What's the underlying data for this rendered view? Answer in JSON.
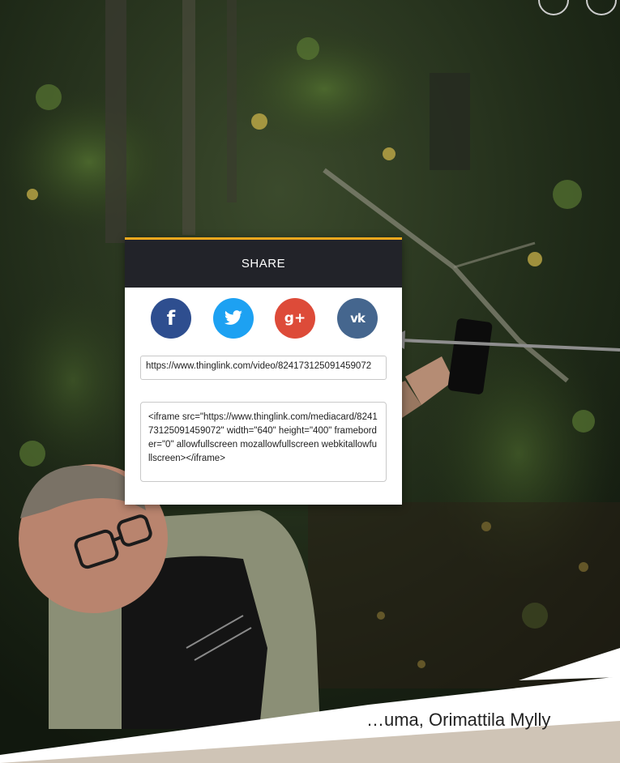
{
  "modal": {
    "title": "SHARE",
    "accent_color": "#f0a81e",
    "header_color": "#222329",
    "social": [
      {
        "name": "facebook",
        "icon": "facebook-icon",
        "glyph": "f",
        "color": "#2e4e8f"
      },
      {
        "name": "twitter",
        "icon": "twitter-icon",
        "glyph": "bird",
        "color": "#1da1f2"
      },
      {
        "name": "google-plus",
        "icon": "google-plus-icon",
        "glyph": "g+",
        "color": "#dd4b39"
      },
      {
        "name": "vk",
        "icon": "vk-icon",
        "glyph": "vk",
        "color": "#45668e"
      }
    ],
    "url_value": "https://www.thinglink.com/video/824173125091459072",
    "embed_value": "<iframe src=\"https://www.thinglink.com/mediacard/824173125091459072\" width=\"640\" height=\"400\" frameborder=\"0\" allowfullscreen mozallowfullscreen webkitallowfullscreen></iframe>"
  },
  "caption": {
    "text": "…uma, Orimattila Mylly"
  }
}
